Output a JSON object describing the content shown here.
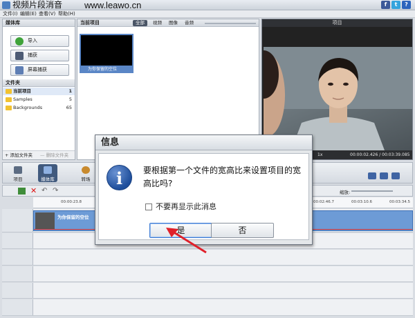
{
  "window": {
    "title": "视频片段消音",
    "watermark": "www.leawo.cn",
    "menu": [
      "文件(I)",
      "编辑(E)",
      "查看(V)",
      "帮助(H)"
    ]
  },
  "library": {
    "header": "媒体库",
    "import_label": "导入",
    "capture_label": "捕获",
    "screen_capture_label": "屏幕捕获",
    "folders_header": "文件夹",
    "folders": [
      {
        "name": "当前项目",
        "count": "1"
      },
      {
        "name": "Samples",
        "count": "5"
      },
      {
        "name": "Backgrounds",
        "count": "65"
      }
    ],
    "add_folder": "+ 添加文件夹",
    "delete_folder": "— 删除文件夹"
  },
  "project": {
    "header": "当前项目",
    "filters": [
      "全部",
      "视频",
      "图像",
      "音频"
    ],
    "clip_name": "为你保留的空位"
  },
  "preview": {
    "header": "项目",
    "speed": "1x",
    "time": "00:00:02.426 / 00:03:39.085"
  },
  "modes": [
    "项目",
    "媒体库",
    "转场"
  ],
  "timeline": {
    "zoom_label": "缩放:",
    "ticks": [
      "00:00:23.8",
      "00:02:46.7",
      "00:03:10.6",
      "00:03:34.5"
    ],
    "clip_title": "为你保留的空位"
  },
  "dialog": {
    "title": "信息",
    "icon": "i",
    "message": "要根据第一个文件的宽高比来设置项目的宽高比吗?",
    "dont_show": "不要再显示此消息",
    "yes": "是",
    "no": "否"
  },
  "colors": {
    "accent": "#3d7bd4",
    "arrow": "#e0202a"
  }
}
